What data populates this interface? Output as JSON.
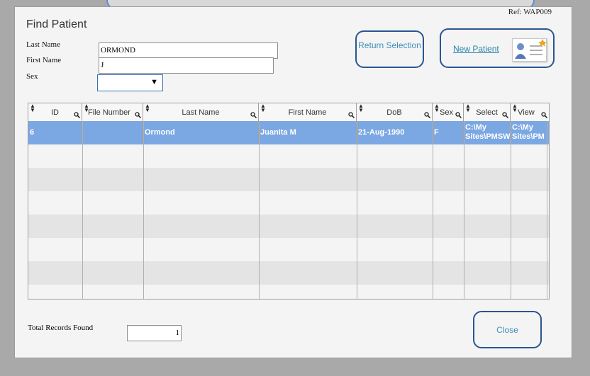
{
  "dialog": {
    "ref": "Ref: WAP009",
    "title": "Find Patient"
  },
  "form": {
    "last_name_label": "Last Name",
    "last_name_value": "ORMOND",
    "first_name_label": "First Name",
    "first_name_value": "J",
    "sex_label": "Sex",
    "sex_value": ""
  },
  "buttons": {
    "return_label": "Return Selection",
    "new_patient_label": "New Patient",
    "close_label": "Close"
  },
  "grid": {
    "columns": [
      "ID",
      "File Number",
      "Last Name",
      "First Name",
      "DoB",
      "Sex",
      "Select",
      "View"
    ],
    "rows": [
      {
        "id": "6",
        "file_number": "",
        "last_name": "Ormond",
        "first_name": "Juanita M",
        "dob": "21-Aug-1990",
        "sex": "F",
        "select": "C:\\My Sites\\PMSW",
        "view": "C:\\My Sites\\PM"
      }
    ],
    "selected_row_color": "#7ba7e3"
  },
  "footer": {
    "total_label": "Total Records Found",
    "total_value": "1"
  },
  "icons": {
    "sort": "sort-arrows-icon",
    "filter": "magnifier-icon",
    "new_patient": "patient-card-icon"
  }
}
